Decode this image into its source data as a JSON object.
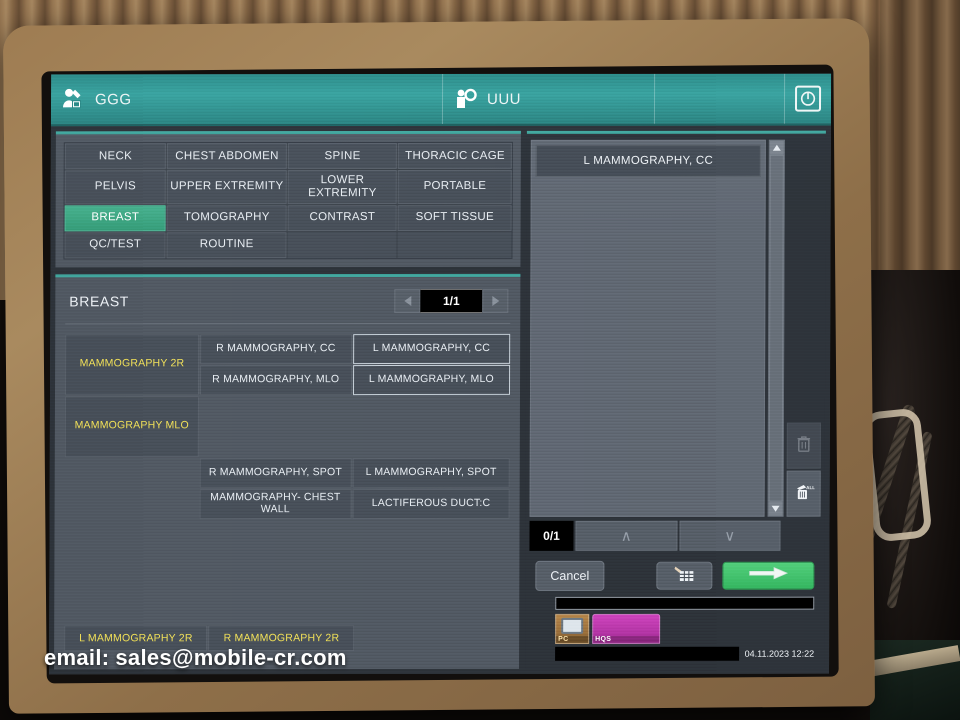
{
  "header": {
    "patient_icon": "patient-edit-icon",
    "patient_id": "GGG",
    "user_icon": "user-icon",
    "user_id": "UUU",
    "power_icon": "power-icon"
  },
  "body_parts": {
    "cells": [
      {
        "label": "NECK",
        "selected": false
      },
      {
        "label": "CHEST ABDOMEN",
        "selected": false
      },
      {
        "label": "SPINE",
        "selected": false
      },
      {
        "label": "THORACIC CAGE",
        "selected": false
      },
      {
        "label": "PELVIS",
        "selected": false
      },
      {
        "label": "UPPER EXTREMITY",
        "selected": false
      },
      {
        "label": "LOWER EXTREMITY",
        "selected": false
      },
      {
        "label": "PORTABLE",
        "selected": false
      },
      {
        "label": "BREAST",
        "selected": true
      },
      {
        "label": "TOMOGRAPHY",
        "selected": false
      },
      {
        "label": "CONTRAST",
        "selected": false
      },
      {
        "label": "SOFT TISSUE",
        "selected": false
      },
      {
        "label": "QC/TEST",
        "selected": false
      },
      {
        "label": "ROUTINE",
        "selected": false
      }
    ]
  },
  "procedures": {
    "title": "BREAST",
    "pager": {
      "prev_icon": "triangle-left-icon",
      "value": "1/1",
      "next_icon": "triangle-right-icon"
    },
    "grid": [
      {
        "label": "MAMMOGRAPHY 2R",
        "style": "yellow"
      },
      {
        "label": "R MAMMOGRAPHY, CC",
        "style": "white"
      },
      {
        "label": "L MAMMOGRAPHY, CC",
        "style": "white-highlight"
      },
      {
        "label": "",
        "style": "blank"
      },
      {
        "label": "R MAMMOGRAPHY, MLO",
        "style": "white"
      },
      {
        "label": "L MAMMOGRAPHY, MLO",
        "style": "white-highlight"
      },
      {
        "label": "MAMMOGRAPHY  MLO",
        "style": "yellow"
      },
      {
        "label": "",
        "style": "blank"
      },
      {
        "label": "",
        "style": "blank"
      },
      {
        "label": "",
        "style": "blank"
      },
      {
        "label": "R MAMMOGRAPHY, SPOT",
        "style": "white"
      },
      {
        "label": "L MAMMOGRAPHY, SPOT",
        "style": "white"
      },
      {
        "label": "",
        "style": "blank"
      },
      {
        "label": "MAMMOGRAPHY- CHEST WALL",
        "style": "white"
      },
      {
        "label": "LACTIFEROUS DUCT:C",
        "style": "white"
      }
    ],
    "bottom_row": [
      {
        "label": "L MAMMOGRAPHY 2R"
      },
      {
        "label": "R MAMMOGRAPHY  2R"
      }
    ]
  },
  "selection": {
    "items": [
      "L MAMMOGRAPHY, CC"
    ],
    "scrollbar": {
      "up_icon": "triangle-up-icon",
      "down_icon": "triangle-down-icon"
    },
    "delete_icon": "trash-icon",
    "delete_all_icon": "trash-all-icon",
    "counter": "0/1",
    "move_up_icon": "chevron-up-icon",
    "move_down_icon": "chevron-down-icon"
  },
  "actions": {
    "cancel_label": "Cancel",
    "worklist_icon": "table-grid-icon",
    "proceed_icon": "arrow-right-icon",
    "accent_green": "#3fbf6a",
    "accent_teal": "#43a8a0"
  },
  "status": {
    "taskbar": [
      {
        "label": "PC",
        "color": "#b98b4e"
      },
      {
        "label": "HQS",
        "color": "#cf46bf"
      }
    ],
    "timestamp": "04.11.2023 12:22"
  },
  "watermark": {
    "label": "email:",
    "address": "sales@mobile-cr.com"
  }
}
